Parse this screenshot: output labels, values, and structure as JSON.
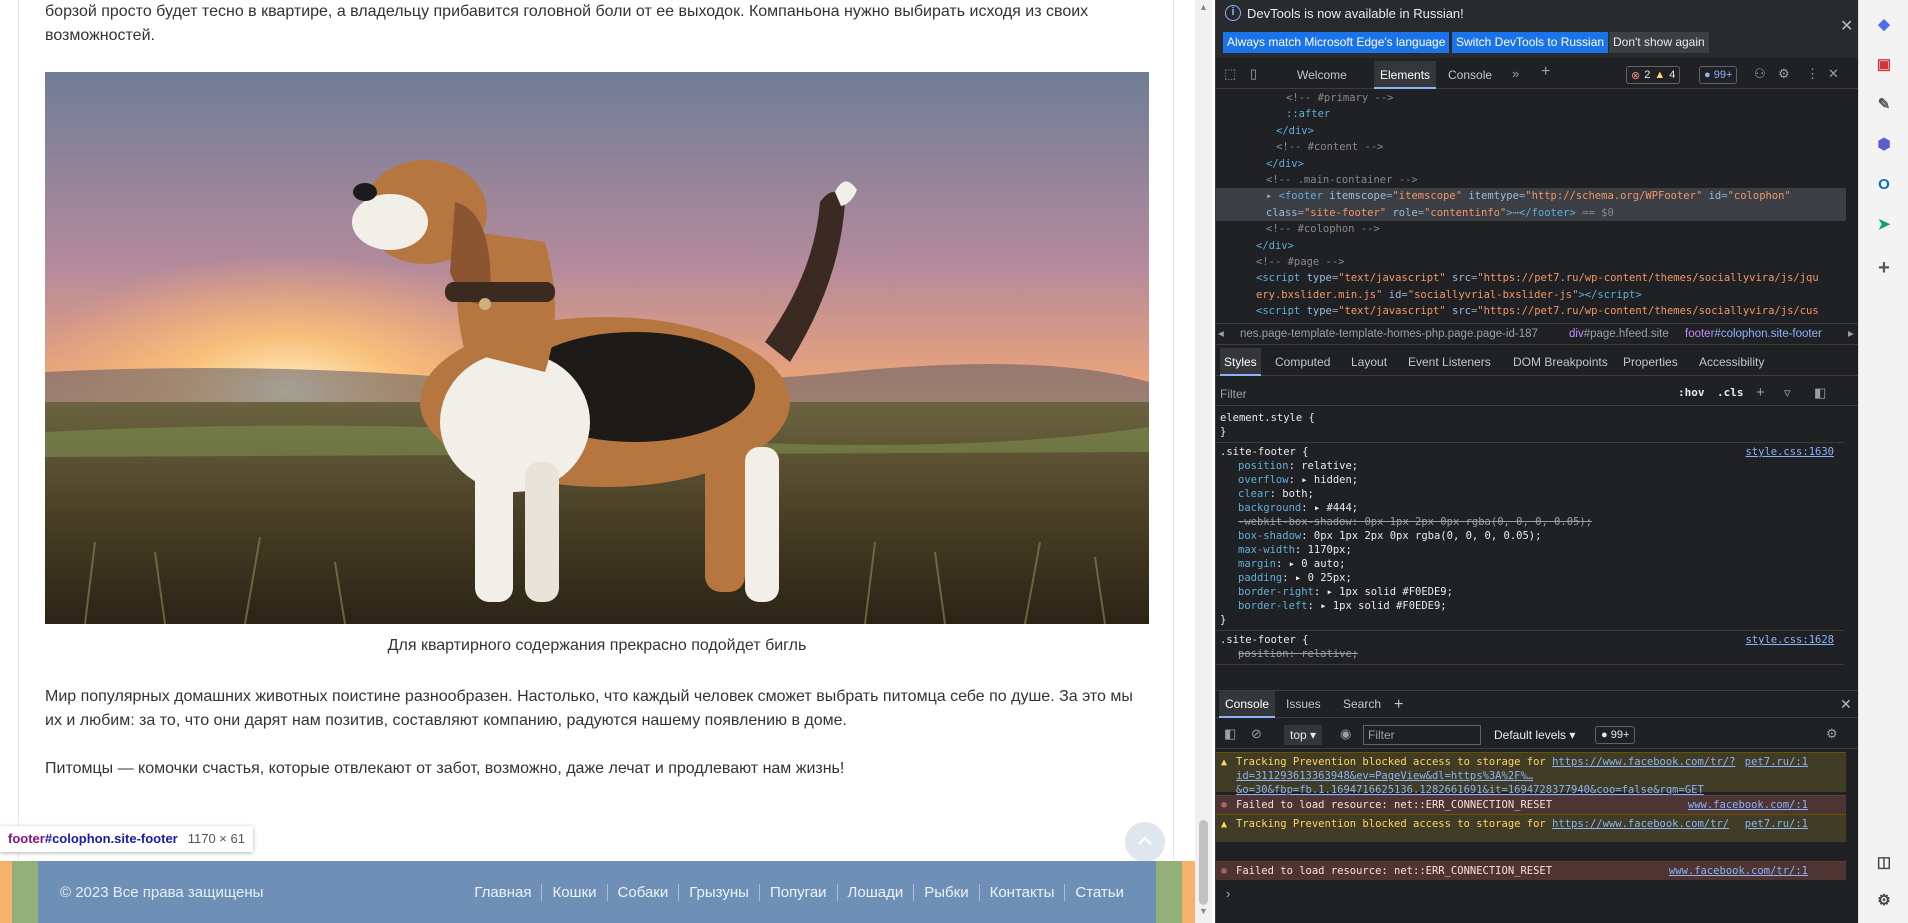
{
  "page": {
    "para_top": "борзой просто будет тесно в квартире, а владельцу прибавится головной боли от ее выходок. Компаньона нужно выбирать исходя из своих возможностей.",
    "caption": "Для квартирного содержания прекрасно подойдет бигль",
    "para_1": "Мир популярных домашних животных поистине разнообразен. Настолько, что каждый человек сможет выбрать питомца себе по душе. За это мы их и любим: за то, что они дарят нам позитив, составляют компанию, радуются нашему появлению в доме.",
    "para_2": "Питомцы — комочки счастья, которые отвлекают от забот, возможно, даже лечат и продлевают нам жизнь!",
    "tooltip_tag": "footer",
    "tooltip_id": "#colophon.site-footer",
    "tooltip_size": "1170 × 61",
    "footer": {
      "copyright": "© 2023 Все права защищены",
      "links": [
        "Главная",
        "Кошки",
        "Собаки",
        "Грызуны",
        "Попугаи",
        "Лошади",
        "Рыбки",
        "Контакты",
        "Статьи"
      ]
    }
  },
  "devtools": {
    "infobar": {
      "text": "DevTools is now available in Russian!",
      "btn_match": "Always match Microsoft Edge's language",
      "btn_switch": "Switch DevTools to Russian",
      "btn_dontshow": "Don't show again"
    },
    "tabs": {
      "welcome": "Welcome",
      "elements": "Elements",
      "console": "Console"
    },
    "issues": {
      "errors": "2",
      "warnings": "4",
      "messages": "99+"
    },
    "dom_lines": [
      {
        "indent": 6,
        "html": "<span class=\"cmt\">&lt;!-- #primary --&gt;</span>"
      },
      {
        "indent": 6,
        "html": "<span class=\"tag\">::after</span>"
      },
      {
        "indent": 5,
        "html": "<span class=\"tag\">&lt;/div&gt;</span>"
      },
      {
        "indent": 5,
        "html": "<span class=\"cmt\">&lt;!-- #content --&gt;</span>"
      },
      {
        "indent": 4,
        "html": "<span class=\"tag\">&lt;/div&gt;</span>"
      },
      {
        "indent": 4,
        "html": "<span class=\"cmt\">&lt;!-- .main-container --&gt;</span>"
      },
      {
        "indent": 4,
        "sel": true,
        "html": "▸ <span class=\"tag\">&lt;footer</span> <span class=\"attr\">itemscope</span>=<span class=\"val\">\"itemscope\"</span> <span class=\"attr\">itemtype</span>=<span class=\"val\">\"http://schema.org/WPFooter\"</span> <span class=\"attr\">id</span>=<span class=\"val\">\"colophon\"</span>"
      },
      {
        "indent": 4,
        "sel": true,
        "html": "<span class=\"attr\">class</span>=<span class=\"val\">\"site-footer\"</span> <span class=\"attr\">role</span>=<span class=\"val\">\"contentinfo\"</span><span class=\"tag\">&gt;</span>⋯<span class=\"tag\">&lt;/footer&gt;</span> <span class=\"cmt\">== $0</span>"
      },
      {
        "indent": 4,
        "html": "<span class=\"cmt\">&lt;!-- #colophon --&gt;</span>"
      },
      {
        "indent": 3,
        "html": "<span class=\"tag\">&lt;/div&gt;</span>"
      },
      {
        "indent": 3,
        "html": "<span class=\"cmt\">&lt;!-- #page --&gt;</span>"
      },
      {
        "indent": 3,
        "html": "<span class=\"tag\">&lt;script</span> <span class=\"attr\">type</span>=<span class=\"val\">\"text/javascript\"</span> <span class=\"attr\">src</span>=<span class=\"val\">\"https://pet7.ru/wp-content/themes/sociallyvira/js/jqu</span>"
      },
      {
        "indent": 3,
        "html": "<span class=\"val\">ery.bxslider.min.js\"</span> <span class=\"attr\">id</span>=<span class=\"val\">\"sociallyvrial-bxslider-js\"</span><span class=\"tag\">&gt;&lt;/script&gt;</span>"
      },
      {
        "indent": 3,
        "html": "<span class=\"tag\">&lt;script</span> <span class=\"attr\">type</span>=<span class=\"val\">\"text/javascript\"</span> <span class=\"attr\">src</span>=<span class=\"val\">\"https://pet7.ru/wp-content/themes/sociallyvira/js/cus</span>"
      }
    ],
    "breadcrumbs": {
      "c1": "nes.page-template-template-homes-php.page.page-id-187",
      "c2_tag": "div",
      "c2_rest": "#page.hfeed.site",
      "c3_tag": "footer",
      "c3_rest": "#colophon.site-footer"
    },
    "styles_tabs": [
      "Styles",
      "Computed",
      "Layout",
      "Event Listeners",
      "DOM Breakpoints",
      "Properties",
      "Accessibility"
    ],
    "styles_filter_placeholder": "Filter",
    "hov": ":hov",
    "cls": ".cls",
    "rules": {
      "element_style": "element.style {",
      "close": "}",
      "site_footer_sel": ".site-footer {",
      "link_1630": "style.css:1630",
      "link_1628": "style.css:1628",
      "decls": [
        {
          "p": "position",
          "v": "relative;"
        },
        {
          "p": "overflow",
          "v": "▸ hidden;"
        },
        {
          "p": "clear",
          "v": "both;"
        },
        {
          "p": "background",
          "v": "▸ #444;"
        },
        {
          "p": "-webkit-box-shadow",
          "v": "0px 1px 2px 0px rgba(0, 0, 0, 0.05);",
          "strike": true
        },
        {
          "p": "box-shadow",
          "v": "0px 1px 2px 0px rgba(0, 0, 0, 0.05);"
        },
        {
          "p": "max-width",
          "v": "1170px;"
        },
        {
          "p": "margin",
          "v": "▸ 0 auto;"
        },
        {
          "p": "padding",
          "v": "▸ 0 25px;"
        },
        {
          "p": "border-right",
          "v": "▸ 1px solid #F0EDE9;"
        },
        {
          "p": "border-left",
          "v": "▸ 1px solid #F0EDE9;"
        }
      ],
      "second_first_decl": "position: relative;"
    },
    "drawer_tabs": [
      "Console",
      "Issues",
      "Search"
    ],
    "console_toolbar": {
      "context": "top",
      "filter_placeholder": "Filter",
      "levels": "Default levels",
      "count": "99+"
    },
    "messages": [
      {
        "type": "warn",
        "text": "Tracking Prevention blocked access to storage for ",
        "link": "https://www.facebook.com/tr/?id=311293613363948&ev=PageView&dl=https%3A%2F%…&o=30&fbp=fb.1.1694716625136.1282661691&it=1694728377940&coo=false&rqm=GET",
        "src": "pet7.ru/:1"
      },
      {
        "type": "err",
        "text": "Failed to load resource: net::ERR_CONNECTION_RESET",
        "link": "",
        "src": "www.facebook.com/:1"
      },
      {
        "type": "warn",
        "text": "Tracking Prevention blocked access to storage for ",
        "link": "https://www.facebook.com/tr/",
        "src": "pet7.ru/:1"
      },
      {
        "type": "err",
        "text": "Failed to load resource: net::ERR_CONNECTION_RESET",
        "link": "",
        "src": "www.facebook.com/tr/:1"
      }
    ]
  },
  "colors": {
    "footer_bg": "#6e90b6",
    "devtools_bg": "#202124",
    "accent": "#1a73e8"
  }
}
